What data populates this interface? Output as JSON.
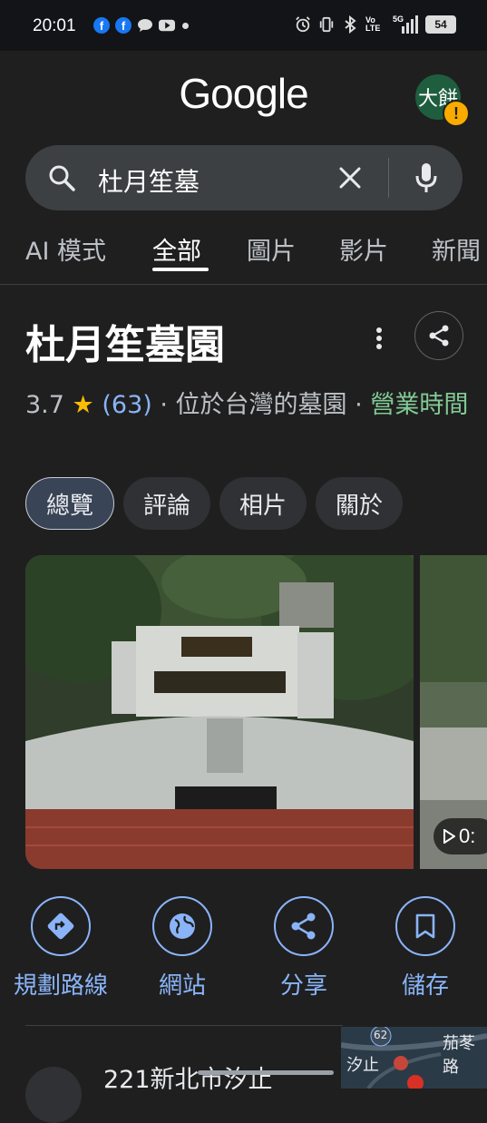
{
  "status_bar": {
    "time": "20:01",
    "battery": "54",
    "network": "5G",
    "volte": "Vo LTE",
    "icons": [
      "facebook-icon",
      "facebook-icon",
      "chat-icon",
      "youtube-icon",
      "dot-icon",
      "alarm-icon",
      "vibrate-icon",
      "bluetooth-icon",
      "volte-icon",
      "signal-icon",
      "battery-icon"
    ]
  },
  "header": {
    "logo": "Google",
    "avatar_text": "大餅",
    "warning": "!"
  },
  "search": {
    "query": "杜月笙墓",
    "icons": [
      "search-icon",
      "clear-icon",
      "mic-icon"
    ]
  },
  "tabs": [
    {
      "label": "AI 模式",
      "active": false
    },
    {
      "label": "全部",
      "active": true
    },
    {
      "label": "圖片",
      "active": false
    },
    {
      "label": "影片",
      "active": false
    },
    {
      "label": "新聞",
      "active": false
    }
  ],
  "place": {
    "title": "杜月笙墓園",
    "rating": "3.7",
    "star": "★",
    "review_count": "(63)",
    "description": "· 位於台灣的墓園 ·",
    "hours_label": "營業時間"
  },
  "chips": [
    {
      "label": "總覽",
      "active": true
    },
    {
      "label": "評論",
      "active": false
    },
    {
      "label": "相片",
      "active": false
    },
    {
      "label": "關於",
      "active": false
    }
  ],
  "photos": {
    "video_badge": "0:"
  },
  "actions": [
    {
      "label": "規劃路線",
      "icon": "directions-icon"
    },
    {
      "label": "網站",
      "icon": "globe-icon"
    },
    {
      "label": "分享",
      "icon": "share-icon"
    },
    {
      "label": "儲存",
      "icon": "bookmark-icon"
    }
  ],
  "address": {
    "text": "221新北市汐止"
  },
  "map": {
    "labels": [
      "汐止",
      "茄苳路",
      "62"
    ]
  },
  "colors": {
    "background": "#1f1f1f",
    "accent_blue": "#8ab4f8",
    "open_green": "#81c995",
    "star_yellow": "#fbbc04",
    "search_bg": "#3c4043"
  }
}
